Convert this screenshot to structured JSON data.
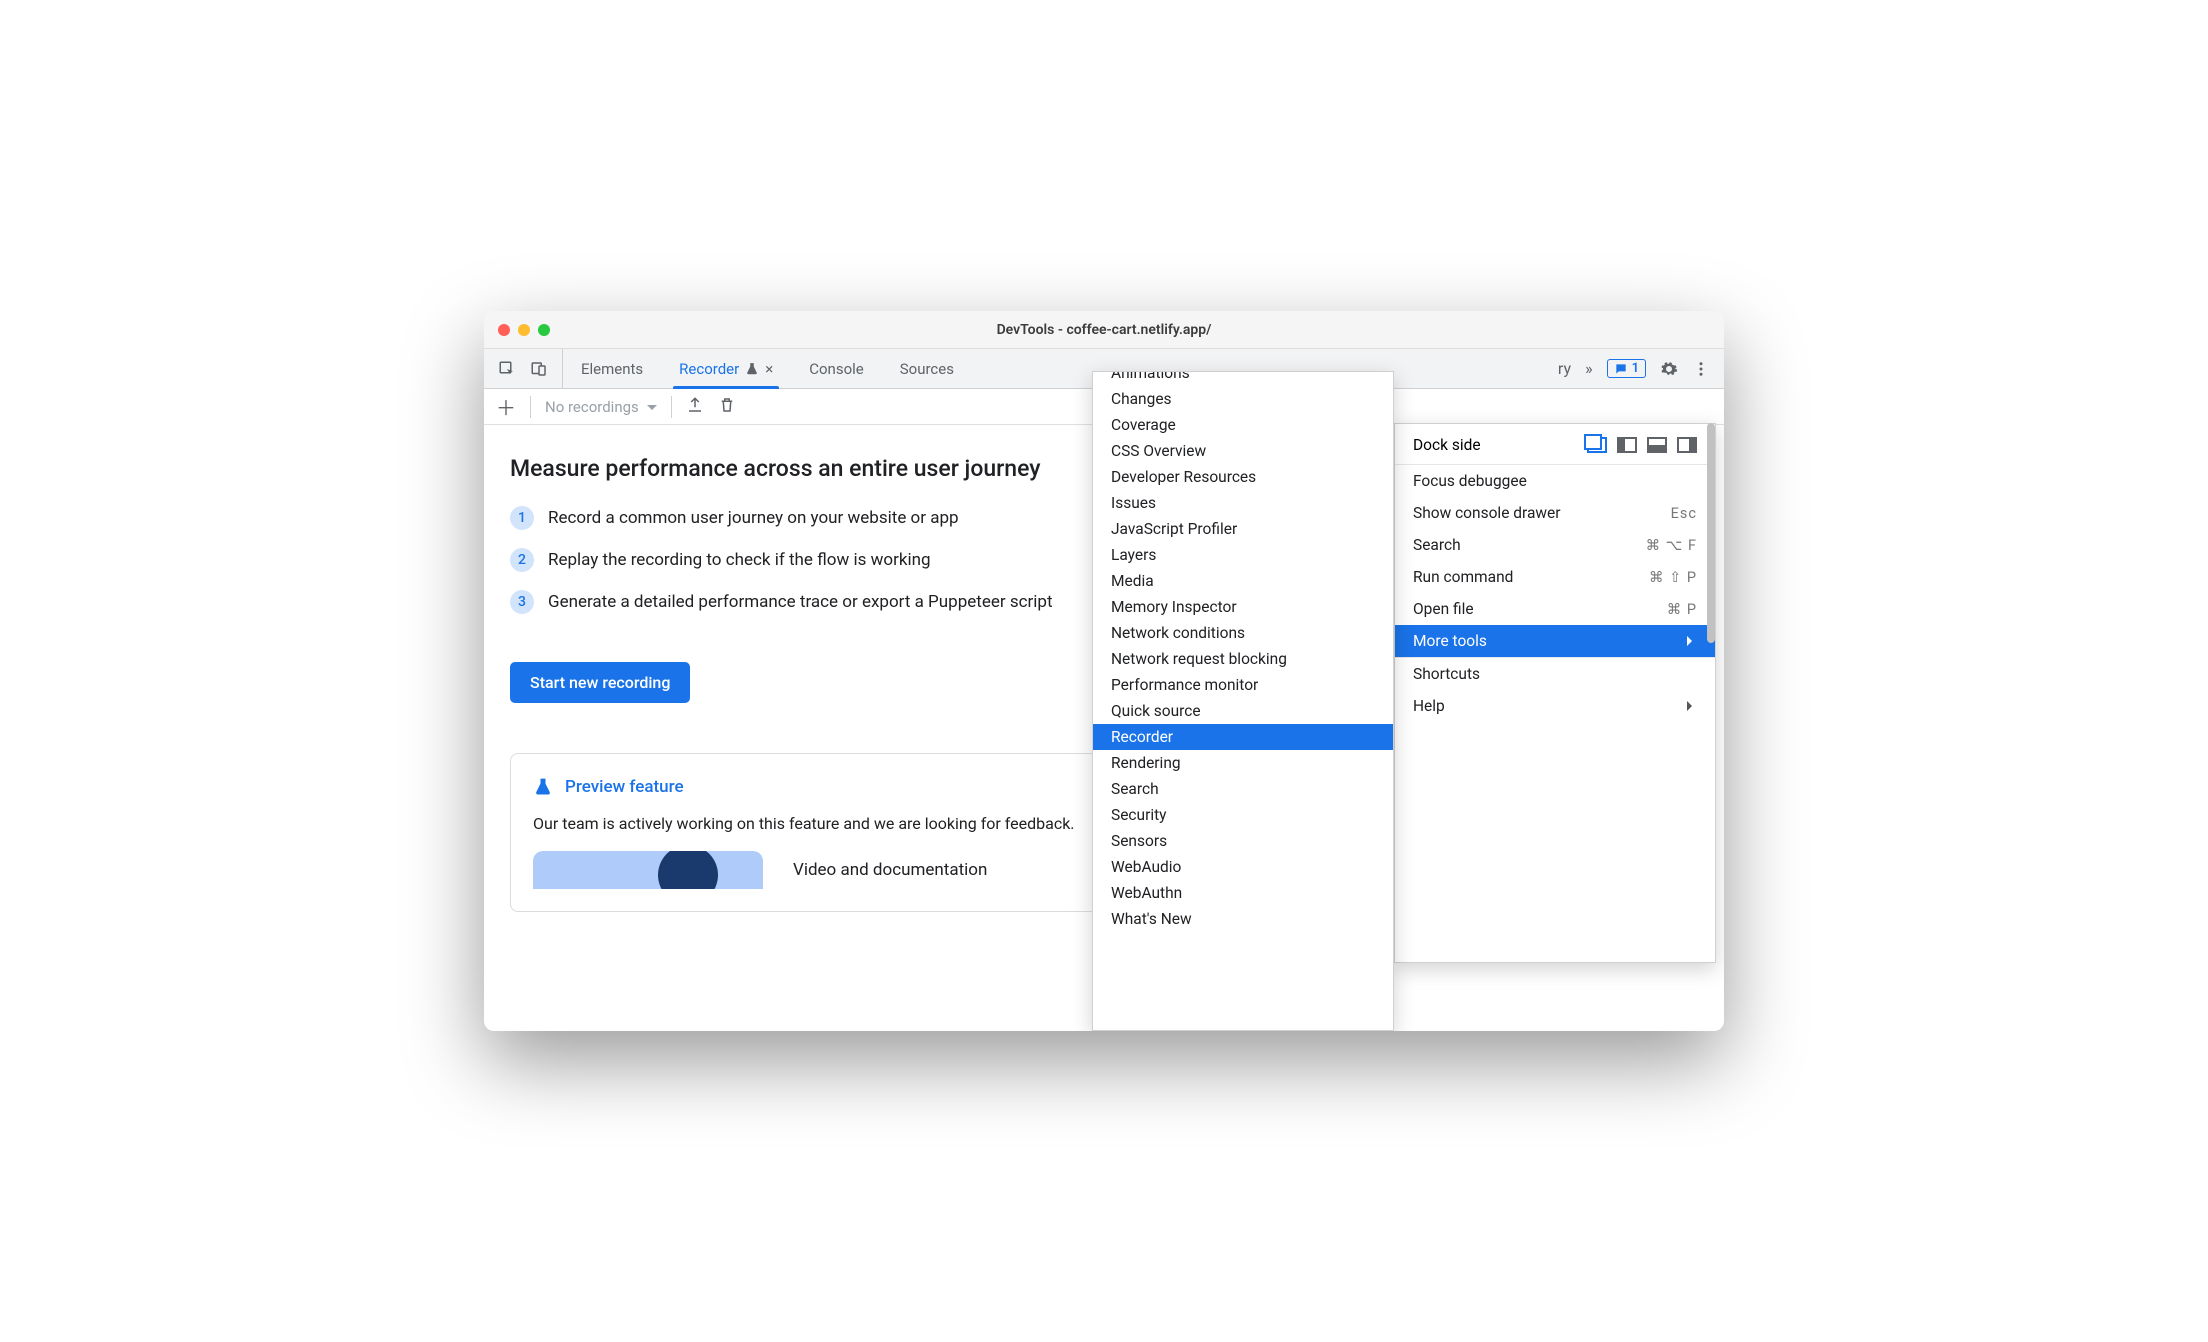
{
  "window_title": "DevTools - coffee-cart.netlify.app/",
  "tabs": {
    "elements": "Elements",
    "recorder": "Recorder",
    "console": "Console",
    "sources": "Sources"
  },
  "overflow_tab_hint": "ry",
  "issues_count": "1",
  "toolbar": {
    "recordings_placeholder": "No recordings"
  },
  "content": {
    "heading": "Measure performance across an entire user journey",
    "step1": "Record a common user journey on your website or app",
    "step2": "Replay the recording to check if the flow is working",
    "step3": "Generate a detailed performance trace or export a Puppeteer script",
    "start_button": "Start new recording"
  },
  "preview": {
    "title": "Preview feature",
    "desc": "Our team is actively working on this feature and we are looking for feedback.",
    "media_title": "Video and documentation"
  },
  "main_menu": {
    "dock_side": "Dock side",
    "items": [
      {
        "label": "Focus debuggee",
        "shortcut": ""
      },
      {
        "label": "Show console drawer",
        "shortcut": "Esc"
      },
      {
        "label": "Search",
        "shortcut": "⌘ ⌥ F"
      },
      {
        "label": "Run command",
        "shortcut": "⌘ ⇧ P"
      },
      {
        "label": "Open file",
        "shortcut": "⌘ P"
      }
    ],
    "more_tools": "More tools",
    "items2": [
      {
        "label": "Shortcuts",
        "shortcut": ""
      },
      {
        "label": "Help",
        "shortcut": "",
        "submenu": true
      }
    ]
  },
  "more_tools_menu": [
    "Animations",
    "Changes",
    "Coverage",
    "CSS Overview",
    "Developer Resources",
    "Issues",
    "JavaScript Profiler",
    "Layers",
    "Media",
    "Memory Inspector",
    "Network conditions",
    "Network request blocking",
    "Performance monitor",
    "Quick source",
    "Recorder",
    "Rendering",
    "Search",
    "Security",
    "Sensors",
    "WebAudio",
    "WebAuthn",
    "What's New"
  ],
  "more_tools_selected": "Recorder"
}
